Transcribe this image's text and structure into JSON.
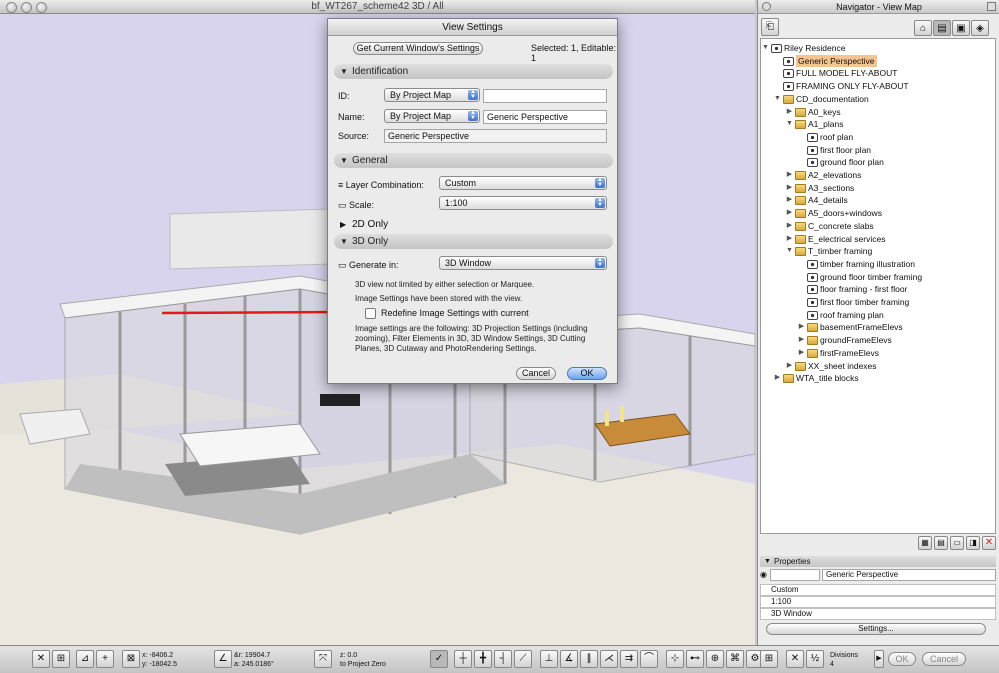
{
  "window3d": {
    "title": "bf_WT267_scheme42 3D / All"
  },
  "dialog": {
    "title": "View Settings",
    "get_current_label": "Get Current Window's Settings",
    "selection_status": "Selected: 1, Editable: 1",
    "identification": {
      "header": "Identification",
      "id_label": "ID:",
      "id_popup": "By Project Map",
      "id_value": "",
      "name_label": "Name:",
      "name_popup": "By Project Map",
      "name_value": "Generic Perspective",
      "source_label": "Source:",
      "source_value": "Generic Perspective"
    },
    "general": {
      "header": "General",
      "layer_label": "Layer Combination:",
      "layer_value": "Custom",
      "scale_label": "Scale:",
      "scale_value": "1:100"
    },
    "section_2d": "2D Only",
    "section_3d": {
      "header": "3D Only",
      "generate_label": "Generate in:",
      "generate_value": "3D Window",
      "note1": "3D view not limited by either selection or Marquee.",
      "note2": "Image Settings have been stored with the view.",
      "redefine_label": "Redefine Image Settings with current",
      "redefine_checked": false,
      "note3": "Image settings are the following: 3D Projection Settings (including zooming), Filter Elements in 3D, 3D Window Settings, 3D Cutting Planes, 3D Cutaway and PhotoRendering Settings."
    },
    "cancel_label": "Cancel",
    "ok_label": "OK"
  },
  "navigator": {
    "title": "Navigator - View Map",
    "tree": [
      {
        "label": "Riley Residence",
        "depth": 0,
        "icon": "home-icon",
        "toggle": "▼"
      },
      {
        "label": "Generic Perspective",
        "depth": 1,
        "icon": "camera-icon",
        "toggle": "",
        "selected": true
      },
      {
        "label": "FULL MODEL FLY-ABOUT",
        "depth": 1,
        "icon": "camera-icon",
        "toggle": ""
      },
      {
        "label": "FRAMING ONLY FLY-ABOUT",
        "depth": 1,
        "icon": "camera-icon",
        "toggle": ""
      },
      {
        "label": "CD_documentation",
        "depth": 1,
        "icon": "folder-icon",
        "toggle": "▼"
      },
      {
        "label": "A0_keys",
        "depth": 2,
        "icon": "folder-icon",
        "toggle": "▶"
      },
      {
        "label": "A1_plans",
        "depth": 2,
        "icon": "folder-icon",
        "toggle": "▼"
      },
      {
        "label": "roof plan",
        "depth": 3,
        "icon": "plan-icon",
        "toggle": ""
      },
      {
        "label": "first floor plan",
        "depth": 3,
        "icon": "plan-icon",
        "toggle": ""
      },
      {
        "label": "ground floor plan",
        "depth": 3,
        "icon": "plan-icon",
        "toggle": ""
      },
      {
        "label": "A2_elevations",
        "depth": 2,
        "icon": "folder-icon",
        "toggle": "▶"
      },
      {
        "label": "A3_sections",
        "depth": 2,
        "icon": "folder-icon",
        "toggle": "▶"
      },
      {
        "label": "A4_details",
        "depth": 2,
        "icon": "folder-icon",
        "toggle": "▶"
      },
      {
        "label": "A5_doors+windows",
        "depth": 2,
        "icon": "folder-icon",
        "toggle": "▶"
      },
      {
        "label": "C_concrete slabs",
        "depth": 2,
        "icon": "folder-icon",
        "toggle": "▶"
      },
      {
        "label": "E_electrical services",
        "depth": 2,
        "icon": "folder-icon",
        "toggle": "▶"
      },
      {
        "label": "T_timber framing",
        "depth": 2,
        "icon": "folder-icon",
        "toggle": "▼"
      },
      {
        "label": "timber framing illustration",
        "depth": 3,
        "icon": "camera-icon",
        "toggle": ""
      },
      {
        "label": "ground floor timber framing",
        "depth": 3,
        "icon": "plan-icon",
        "toggle": ""
      },
      {
        "label": "floor framing - first floor",
        "depth": 3,
        "icon": "plan-icon",
        "toggle": ""
      },
      {
        "label": "first floor timber framing",
        "depth": 3,
        "icon": "plan-icon",
        "toggle": ""
      },
      {
        "label": "roof framing plan",
        "depth": 3,
        "icon": "plan-icon",
        "toggle": ""
      },
      {
        "label": "basementFrameElevs",
        "depth": 3,
        "icon": "folder-icon",
        "toggle": "▶"
      },
      {
        "label": "groundFrameElevs",
        "depth": 3,
        "icon": "folder-icon",
        "toggle": "▶"
      },
      {
        "label": "firstFrameElevs",
        "depth": 3,
        "icon": "folder-icon",
        "toggle": "▶"
      },
      {
        "label": "XX_sheet indexes",
        "depth": 2,
        "icon": "folder-icon",
        "toggle": "▶"
      },
      {
        "label": "WTA_title blocks",
        "depth": 1,
        "icon": "folder-icon",
        "toggle": "▶"
      }
    ],
    "properties": {
      "header": "Properties",
      "name_value": "Generic Perspective",
      "layer": "Custom",
      "scale": "1:100",
      "generate": "3D Window",
      "settings_label": "Settings..."
    }
  },
  "toolbar": {
    "x_label": "x:",
    "x_value": "-8406.2",
    "y_label": "y:",
    "y_value": "-18042.5",
    "r_label": "&r:",
    "r_value": "19904.7",
    "a_label": "a:",
    "a_value": "245.0186°",
    "z_label": "z:",
    "z_value": "0.0",
    "z_ref": "to Project Zero",
    "divisions_label": "Divisions",
    "divisions_value": "4",
    "ok_label": "OK",
    "cancel_label": "Cancel"
  },
  "colors": {
    "sky": "#d9d4ee",
    "highlight": "#f6c48f",
    "arrow": "#e41a1a"
  }
}
